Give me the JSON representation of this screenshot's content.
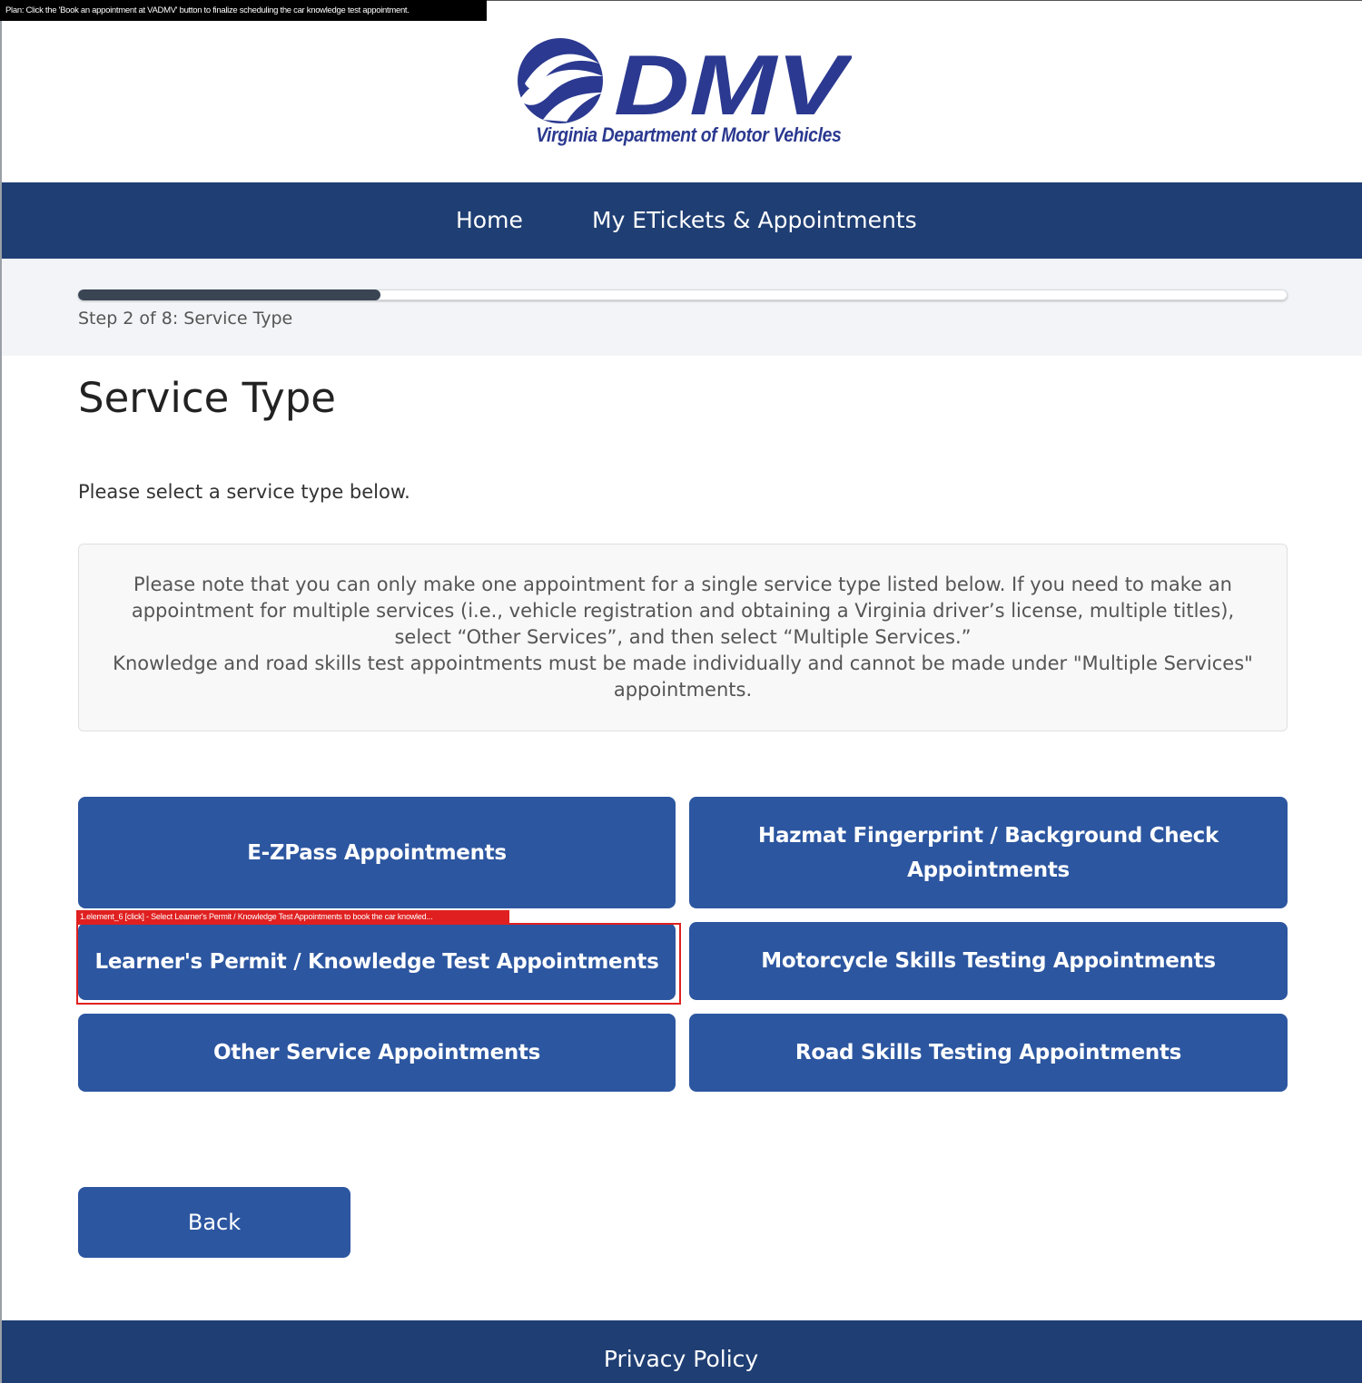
{
  "overlay": {
    "plan_text": "Plan: Click the 'Book an appointment at VADMV' button to finalize scheduling the car knowledge test appointment.",
    "target_label": "1.element_6 [click] - Select Learner's Permit / Knowledge Test Appointments to book the car knowled..."
  },
  "header": {
    "logo_text": "DMV",
    "logo_subtitle": "Virginia Department of Motor Vehicles"
  },
  "nav": {
    "home": "Home",
    "my_etickets": "My ETickets & Appointments"
  },
  "progress": {
    "current_step": 2,
    "total_steps": 8,
    "fill_fraction": 0.25,
    "label": "Step 2 of 8: Service Type"
  },
  "main": {
    "title": "Service Type",
    "intro": "Please select a service type below.",
    "notice_line1": "Please note that you can only make one appointment for a single service type listed below. If you need to make an appointment for multiple services (i.e., vehicle registration and obtaining a Virginia driver’s license, multiple titles), select “Other Services”, and then select “Multiple Services.”",
    "notice_line2": "Knowledge and road skills test appointments must be made individually and cannot be made under \"Multiple Services\" appointments."
  },
  "services": {
    "ezpass": "E-ZPass Appointments",
    "hazmat": "Hazmat Fingerprint / Background Check Appointments",
    "learners": "Learner's Permit / Knowledge Test Appointments",
    "motorcycle": "Motorcycle Skills Testing Appointments",
    "other": "Other Service Appointments",
    "road": "Road Skills Testing Appointments"
  },
  "actions": {
    "back": "Back"
  },
  "footer": {
    "privacy": "Privacy Policy"
  },
  "colors": {
    "navy": "#1f3e73",
    "button_blue": "#2c56a0",
    "logo_blue": "#2b3990",
    "highlight_red": "#e02020"
  }
}
